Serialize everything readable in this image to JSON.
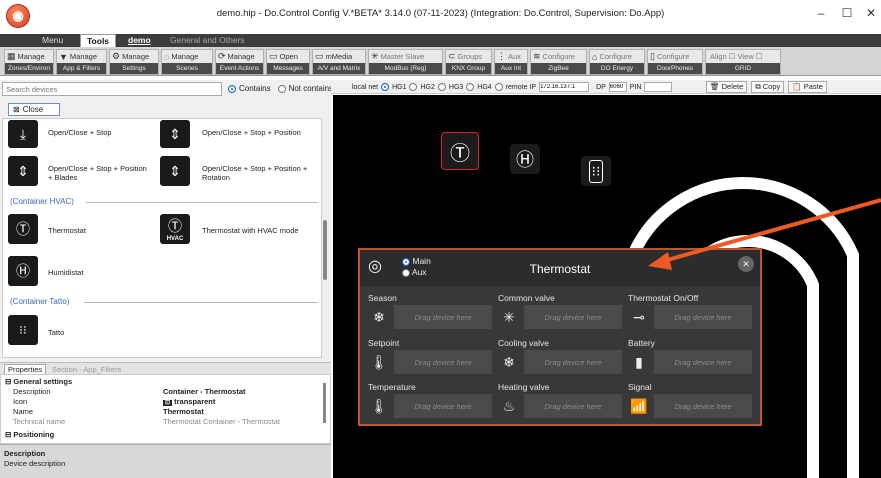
{
  "window": {
    "title": "demo.hip - Do.Control Config V.*BETA* 3.14.0 (07-11-2023) (Integration: Do.Control, Supervision: Do.App)",
    "min": "–",
    "max": "☐",
    "close": "✕"
  },
  "menu": {
    "menu": "Menu",
    "tools": "Tools",
    "demo": "demo",
    "general": "General and Others"
  },
  "ribbon": [
    {
      "top": "Manage",
      "bottom": "Zones/Environ",
      "icon": "▦"
    },
    {
      "top": "Manage",
      "bottom": "App & Filters",
      "icon": "▼"
    },
    {
      "top": "Manage",
      "bottom": "Settings",
      "icon": "⚙"
    },
    {
      "top": "Manage",
      "bottom": "Scenes",
      "icon": "◌"
    },
    {
      "top": "Manage",
      "bottom": "Event Actions",
      "icon": "⟳"
    },
    {
      "top": "Open",
      "bottom": "Messages",
      "icon": "▭"
    },
    {
      "top": "mMedia",
      "bottom": "A/V and Matrix",
      "icon": "▭"
    },
    {
      "top": "Master  Slave",
      "bottom": "ModBus (Reg)",
      "icon": "✳"
    },
    {
      "top": "Groups",
      "bottom": "KNX Group",
      "icon": "⊂"
    },
    {
      "top": "Aux",
      "bottom": "Aux Int",
      "icon": "⋮"
    },
    {
      "top": "Configure",
      "bottom": "ZigBee",
      "icon": "≋"
    },
    {
      "top": "Configure",
      "bottom": "DO Energy",
      "icon": "⌂"
    },
    {
      "top": "Configure",
      "bottom": "DoorPhones",
      "icon": "▯"
    },
    {
      "top": "Align ☐  View ☐",
      "bottom": "GRID",
      "icon": ""
    }
  ],
  "left": {
    "search_placeholder": "Search devices",
    "contains": "Contains",
    "not_contains": "Not contains",
    "close": "Close",
    "devices": {
      "d1": "Open/Close + Stop",
      "d2": "Open/Close + Stop + Position",
      "d3": "Open/Close + Stop + Position + Blades",
      "d4": "Open/Close + Stop + Position + Rotation",
      "hvac_container": "(Container HVAC)",
      "thermostat": "Thermostat",
      "thermostat_hvac": "Thermostat with HVAC mode",
      "hvac_badge": "HVAC",
      "humidistat": "Humidistat",
      "tatto_container": "(Container Tatto)",
      "tatto": "Tatto"
    },
    "props_tab": "Properties",
    "section_tab": "Section - App_Filters",
    "general_settings": "General settings",
    "p_desc": "Description",
    "p_icon": "Icon",
    "p_name": "Name",
    "p_tech": "Technical name",
    "v_desc": "Container - Thermostat",
    "v_icon": "transparent",
    "v_name": "Thermostat",
    "v_tech": "Thermostat Container - Thermostat",
    "positioning": "Positioning",
    "desc_title": "Description",
    "desc_text": "Device description"
  },
  "toolbar": {
    "localnet": "local net",
    "hg1": "HG1",
    "hg2": "HG2",
    "hg3": "HG3",
    "hg4": "HG4",
    "remote_ip": "remote IP",
    "ip": "172.16.137.1",
    "dp": "DP",
    "port": "6060",
    "pin": "PIN",
    "delete": "Delete",
    "copy": "Copy",
    "paste": "Paste"
  },
  "panel": {
    "title": "Thermostat",
    "main": "Main",
    "aux": "Aux",
    "close": "✕",
    "drop": "Drag device here",
    "season": "Season",
    "common_valve": "Common valve",
    "onoff": "Thermostat On/Off",
    "setpoint": "Setpoint",
    "cooling": "Cooling valve",
    "battery": "Battery",
    "temperature": "Temperature",
    "heating": "Heating valve",
    "signal": "Signal"
  },
  "colors": {
    "accent": "#c3532a",
    "arrow": "#ee5a24",
    "radio": "#1a62c8"
  }
}
